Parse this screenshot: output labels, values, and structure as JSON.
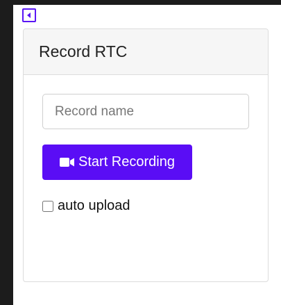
{
  "panel": {
    "title": "Record RTC"
  },
  "record_name": {
    "value": "",
    "placeholder": "Record name"
  },
  "record_button": {
    "label": "Start Recording",
    "icon": "video-camera-icon"
  },
  "auto_upload": {
    "label": "auto upload",
    "checked": false
  },
  "collapse_button": {
    "icon": "caret-left-icon"
  },
  "colors": {
    "accent": "#5a0df5",
    "header_bg": "#f6f6f6",
    "border": "#dcdcdc"
  }
}
